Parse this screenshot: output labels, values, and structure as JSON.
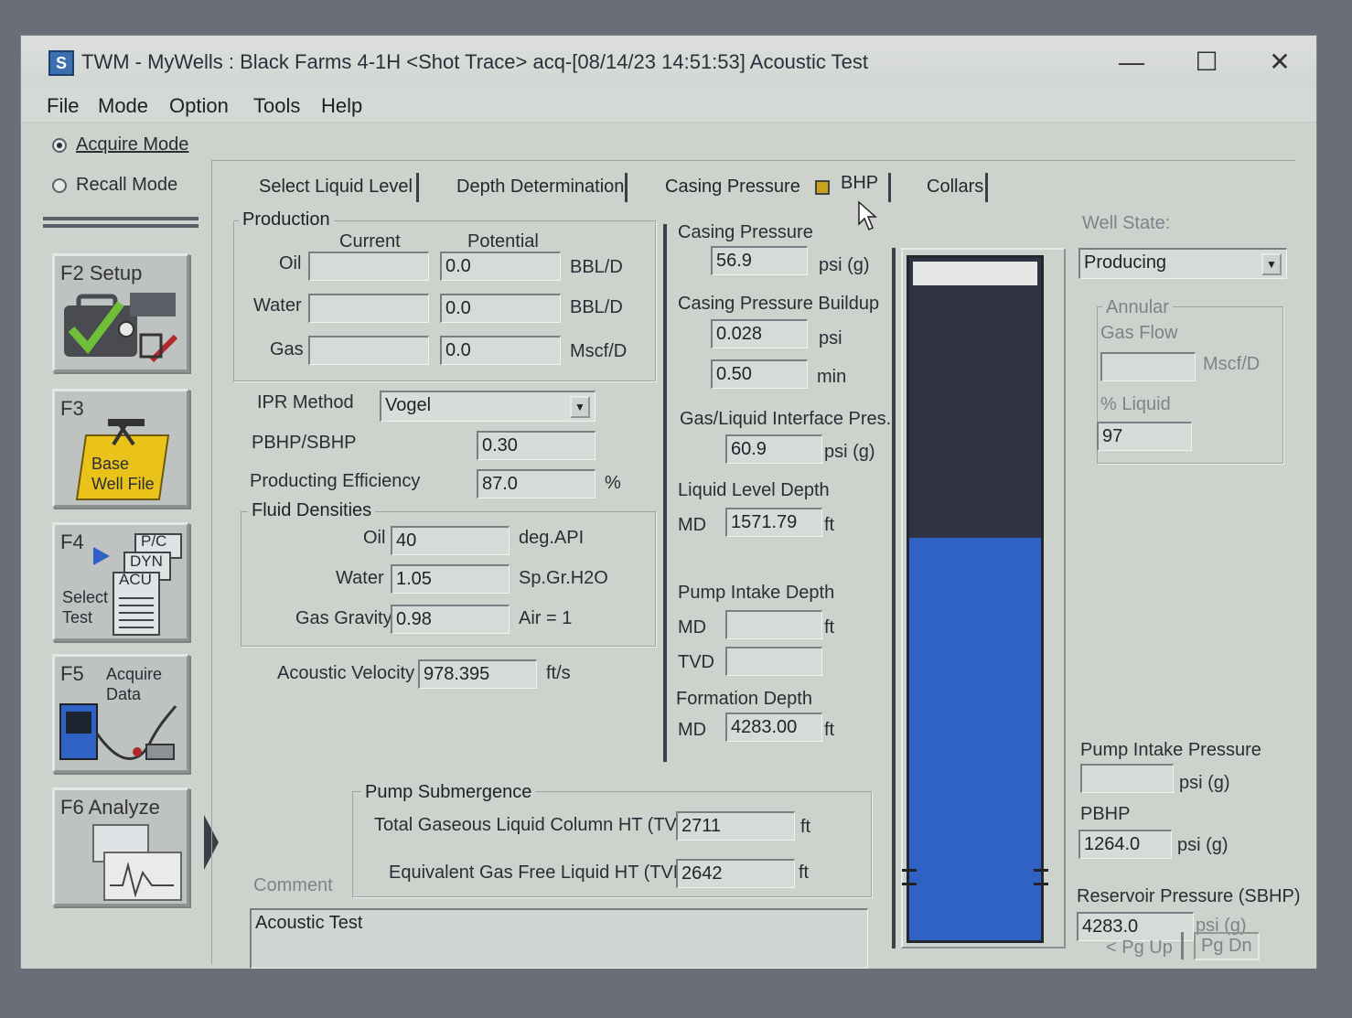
{
  "window": {
    "title": "TWM  -  MyWells : Black Farms 4-1H  <Shot Trace>  acq-[08/14/23 14:51:53]  Acoustic Test",
    "app_icon": "twm-app-icon",
    "controls": {
      "minimize": "—",
      "maximize": "☐",
      "close": "✕"
    }
  },
  "menu": [
    "File",
    "Mode",
    "Option",
    "Tools",
    "Help"
  ],
  "sidebar": {
    "modes": [
      {
        "label": "Acquire Mode",
        "selected": true
      },
      {
        "label": "Recall Mode",
        "selected": false
      }
    ],
    "buttons": [
      {
        "key": "F2",
        "label": "Setup"
      },
      {
        "key": "F3",
        "label_line1": "Base",
        "label_line2": "Well File"
      },
      {
        "key": "F4",
        "tag1": "P/C",
        "tag2": "DYN",
        "tag3": "ACU",
        "label_line1": "Select",
        "label_line2": "Test"
      },
      {
        "key": "F5",
        "label_line1": "Acquire",
        "label_line2": "Data"
      },
      {
        "key": "F6",
        "label": "Analyze"
      }
    ]
  },
  "tabs": [
    {
      "label": "Select Liquid Level"
    },
    {
      "label": "Depth Determination"
    },
    {
      "label": "Casing Pressure"
    },
    {
      "label": "BHP",
      "active": true
    },
    {
      "label": "Collars"
    }
  ],
  "production": {
    "title": "Production",
    "col_current": "Current",
    "col_potential": "Potential",
    "rows": [
      {
        "label": "Oil",
        "current": "",
        "potential": "0.0",
        "unit": "BBL/D"
      },
      {
        "label": "Water",
        "current": "",
        "potential": "0.0",
        "unit": "BBL/D"
      },
      {
        "label": "Gas",
        "current": "",
        "potential": "0.0",
        "unit": "Mscf/D"
      }
    ]
  },
  "ipr": {
    "label": "IPR Method",
    "value": "Vogel"
  },
  "pbhp_sbhp": {
    "label": "PBHP/SBHP",
    "value": "0.30"
  },
  "producing_efficiency": {
    "label": "Producting Efficiency",
    "value": "87.0",
    "unit": "%"
  },
  "fluid_densities": {
    "title": "Fluid Densities",
    "oil": {
      "label": "Oil",
      "value": "40",
      "unit": "deg.API"
    },
    "water": {
      "label": "Water",
      "value": "1.05",
      "unit": "Sp.Gr.H2O"
    },
    "gas": {
      "label": "Gas Gravity",
      "value": "0.98",
      "unit": "Air = 1"
    }
  },
  "acoustic_velocity": {
    "label": "Acoustic Velocity",
    "value": "978.395",
    "unit": "ft/s"
  },
  "casing": {
    "pressure_label": "Casing Pressure",
    "pressure_value": "56.9",
    "pressure_unit": "psi (g)",
    "buildup_label": "Casing Pressure Buildup",
    "buildup_value": "0.028",
    "buildup_unit": "psi",
    "buildup_time": "0.50",
    "buildup_time_unit": "min",
    "interface_label": "Gas/Liquid Interface Pres.",
    "interface_value": "60.9",
    "interface_unit": "psi (g)"
  },
  "liquid_level": {
    "label": "Liquid Level Depth",
    "md_label": "MD",
    "md_value": "1571.79",
    "unit": "ft"
  },
  "pump_intake": {
    "label": "Pump Intake Depth",
    "md_label": "MD",
    "md_value": "",
    "tvd_label": "TVD",
    "tvd_value": "",
    "unit": "ft"
  },
  "formation": {
    "label": "Formation Depth",
    "md_label": "MD",
    "md_value": "4283.00",
    "unit": "ft"
  },
  "submergence": {
    "title": "Pump Submergence",
    "total_label": "Total Gaseous Liquid Column HT (TVD)",
    "total_value": "2711",
    "total_unit": "ft",
    "gasfree_label": "Equivalent Gas Free Liquid HT  (TVD)",
    "gasfree_value": "2642",
    "gasfree_unit": "ft"
  },
  "comment": {
    "label": "Comment",
    "value": "Acoustic Test"
  },
  "wellbore": {
    "gas_fraction": 0.27,
    "liquid_fraction": 0.59
  },
  "well_state": {
    "label": "Well State:",
    "value": "Producing"
  },
  "annular": {
    "title": "Annular",
    "gas_flow_label": "Gas Flow",
    "gas_flow_value": "",
    "gas_flow_unit": "Mscf/D",
    "liquid_label": "% Liquid",
    "liquid_value": "97"
  },
  "pip": {
    "label": "Pump Intake Pressure",
    "value": "",
    "unit": "psi (g)"
  },
  "pbhp": {
    "label": "PBHP",
    "value": "1264.0",
    "unit": "psi (g)"
  },
  "reservoir": {
    "label": "Reservoir Pressure (SBHP)",
    "value": "4283.0",
    "unit": "psi (g)"
  },
  "paging": {
    "up": "< Pg Up",
    "down": "Pg Dn"
  },
  "colors": {
    "gas": "#2f3342",
    "liquid": "#2f62c4",
    "top": "#e6e8e6"
  }
}
